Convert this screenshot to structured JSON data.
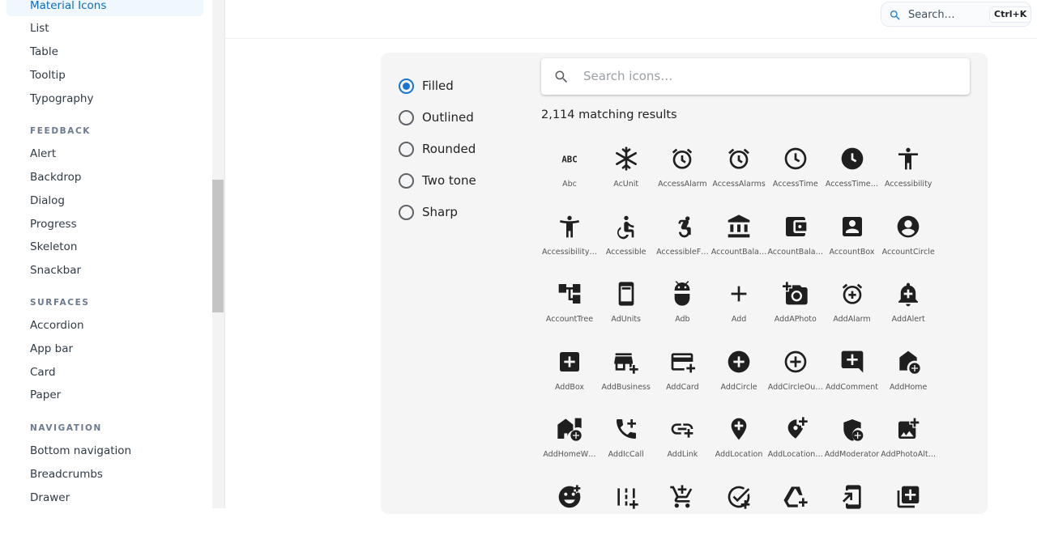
{
  "sidebar": {
    "items": [
      {
        "label": "Material Icons",
        "active": true
      },
      {
        "label": "List"
      },
      {
        "label": "Table"
      },
      {
        "label": "Tooltip"
      },
      {
        "label": "Typography"
      }
    ],
    "sections": [
      {
        "title": "FEEDBACK",
        "items": [
          "Alert",
          "Backdrop",
          "Dialog",
          "Progress",
          "Skeleton",
          "Snackbar"
        ]
      },
      {
        "title": "SURFACES",
        "items": [
          "Accordion",
          "App bar",
          "Card",
          "Paper"
        ]
      },
      {
        "title": "NAVIGATION",
        "items": [
          "Bottom navigation",
          "Breadcrumbs",
          "Drawer"
        ]
      }
    ]
  },
  "header": {
    "search_label": "Search…",
    "shortcut": "Ctrl+K"
  },
  "filters": {
    "options": [
      "Filled",
      "Outlined",
      "Rounded",
      "Two tone",
      "Sharp"
    ],
    "selected": "Filled"
  },
  "icon_search": {
    "placeholder": "Search icons…"
  },
  "results_text": "2,114 matching results",
  "icons": [
    {
      "label": "Abc",
      "icon": "abc-icon"
    },
    {
      "label": "AcUnit",
      "icon": "ac-unit-icon"
    },
    {
      "label": "AccessAlarm",
      "icon": "access-alarm-icon"
    },
    {
      "label": "AccessAlarms",
      "icon": "access-alarms-icon"
    },
    {
      "label": "AccessTime",
      "icon": "access-time-icon"
    },
    {
      "label": "AccessTime…",
      "icon": "access-time-filled-icon"
    },
    {
      "label": "Accessibility",
      "icon": "accessibility-icon"
    },
    {
      "label": "Accessibility…",
      "icon": "accessibility-new-icon"
    },
    {
      "label": "Accessible",
      "icon": "accessible-icon"
    },
    {
      "label": "AccessibleF…",
      "icon": "accessible-forward-icon"
    },
    {
      "label": "AccountBala…",
      "icon": "account-balance-icon"
    },
    {
      "label": "AccountBala…",
      "icon": "account-balance-wallet-icon"
    },
    {
      "label": "AccountBox",
      "icon": "account-box-icon"
    },
    {
      "label": "AccountCircle",
      "icon": "account-circle-icon"
    },
    {
      "label": "AccountTree",
      "icon": "account-tree-icon"
    },
    {
      "label": "AdUnits",
      "icon": "ad-units-icon"
    },
    {
      "label": "Adb",
      "icon": "adb-icon"
    },
    {
      "label": "Add",
      "icon": "add-icon"
    },
    {
      "label": "AddAPhoto",
      "icon": "add-a-photo-icon"
    },
    {
      "label": "AddAlarm",
      "icon": "add-alarm-icon"
    },
    {
      "label": "AddAlert",
      "icon": "add-alert-icon"
    },
    {
      "label": "AddBox",
      "icon": "add-box-icon"
    },
    {
      "label": "AddBusiness",
      "icon": "add-business-icon"
    },
    {
      "label": "AddCard",
      "icon": "add-card-icon"
    },
    {
      "label": "AddCircle",
      "icon": "add-circle-icon"
    },
    {
      "label": "AddCircleOu…",
      "icon": "add-circle-outline-icon"
    },
    {
      "label": "AddComment",
      "icon": "add-comment-icon"
    },
    {
      "label": "AddHome",
      "icon": "add-home-icon"
    },
    {
      "label": "AddHomeW…",
      "icon": "add-home-work-icon"
    },
    {
      "label": "AddIcCall",
      "icon": "add-ic-call-icon"
    },
    {
      "label": "AddLink",
      "icon": "add-link-icon"
    },
    {
      "label": "AddLocation",
      "icon": "add-location-icon"
    },
    {
      "label": "AddLocation…",
      "icon": "add-location-alt-icon"
    },
    {
      "label": "AddModerator",
      "icon": "add-moderator-icon"
    },
    {
      "label": "AddPhotoAlt…",
      "icon": "add-photo-alternate-icon"
    },
    {
      "label": "",
      "icon": "add-reaction-icon"
    },
    {
      "label": "",
      "icon": "add-road-icon"
    },
    {
      "label": "",
      "icon": "add-shopping-cart-icon"
    },
    {
      "label": "",
      "icon": "add-task-icon"
    },
    {
      "label": "",
      "icon": "add-to-drive-icon"
    },
    {
      "label": "",
      "icon": "add-to-home-screen-icon"
    },
    {
      "label": "",
      "icon": "add-to-photos-icon"
    }
  ],
  "colors": {
    "accent": "#1976d2",
    "active_nav_bg": "#f0f7ff",
    "active_nav_text": "#0b6bcb",
    "panel_bg": "#f5f5f5",
    "icon_color": "#1f1f1f"
  }
}
